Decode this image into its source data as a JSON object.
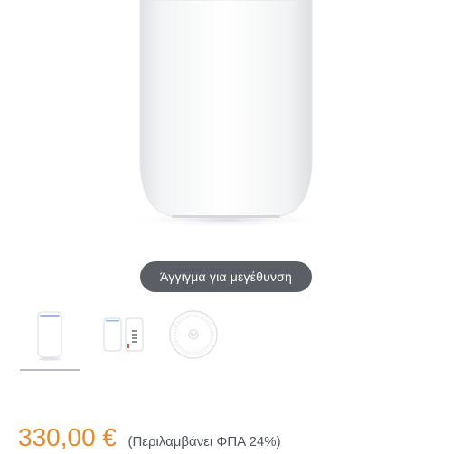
{
  "product": {
    "zoom_hint": "Άγγιγμα για μεγέθυνση",
    "price": "330,00 €",
    "vat_note": "(Περιλαμβάνει ΦΠΑ 24%)"
  },
  "thumbnails": [
    {
      "name": "thumb-front-view",
      "active": true
    },
    {
      "name": "thumb-side-views",
      "active": false
    },
    {
      "name": "thumb-top-view",
      "active": false
    }
  ],
  "colors": {
    "price": "#e58a2d",
    "zoom_hint_bg": "#5c5e66",
    "active_indicator": "#b8bcc3"
  }
}
